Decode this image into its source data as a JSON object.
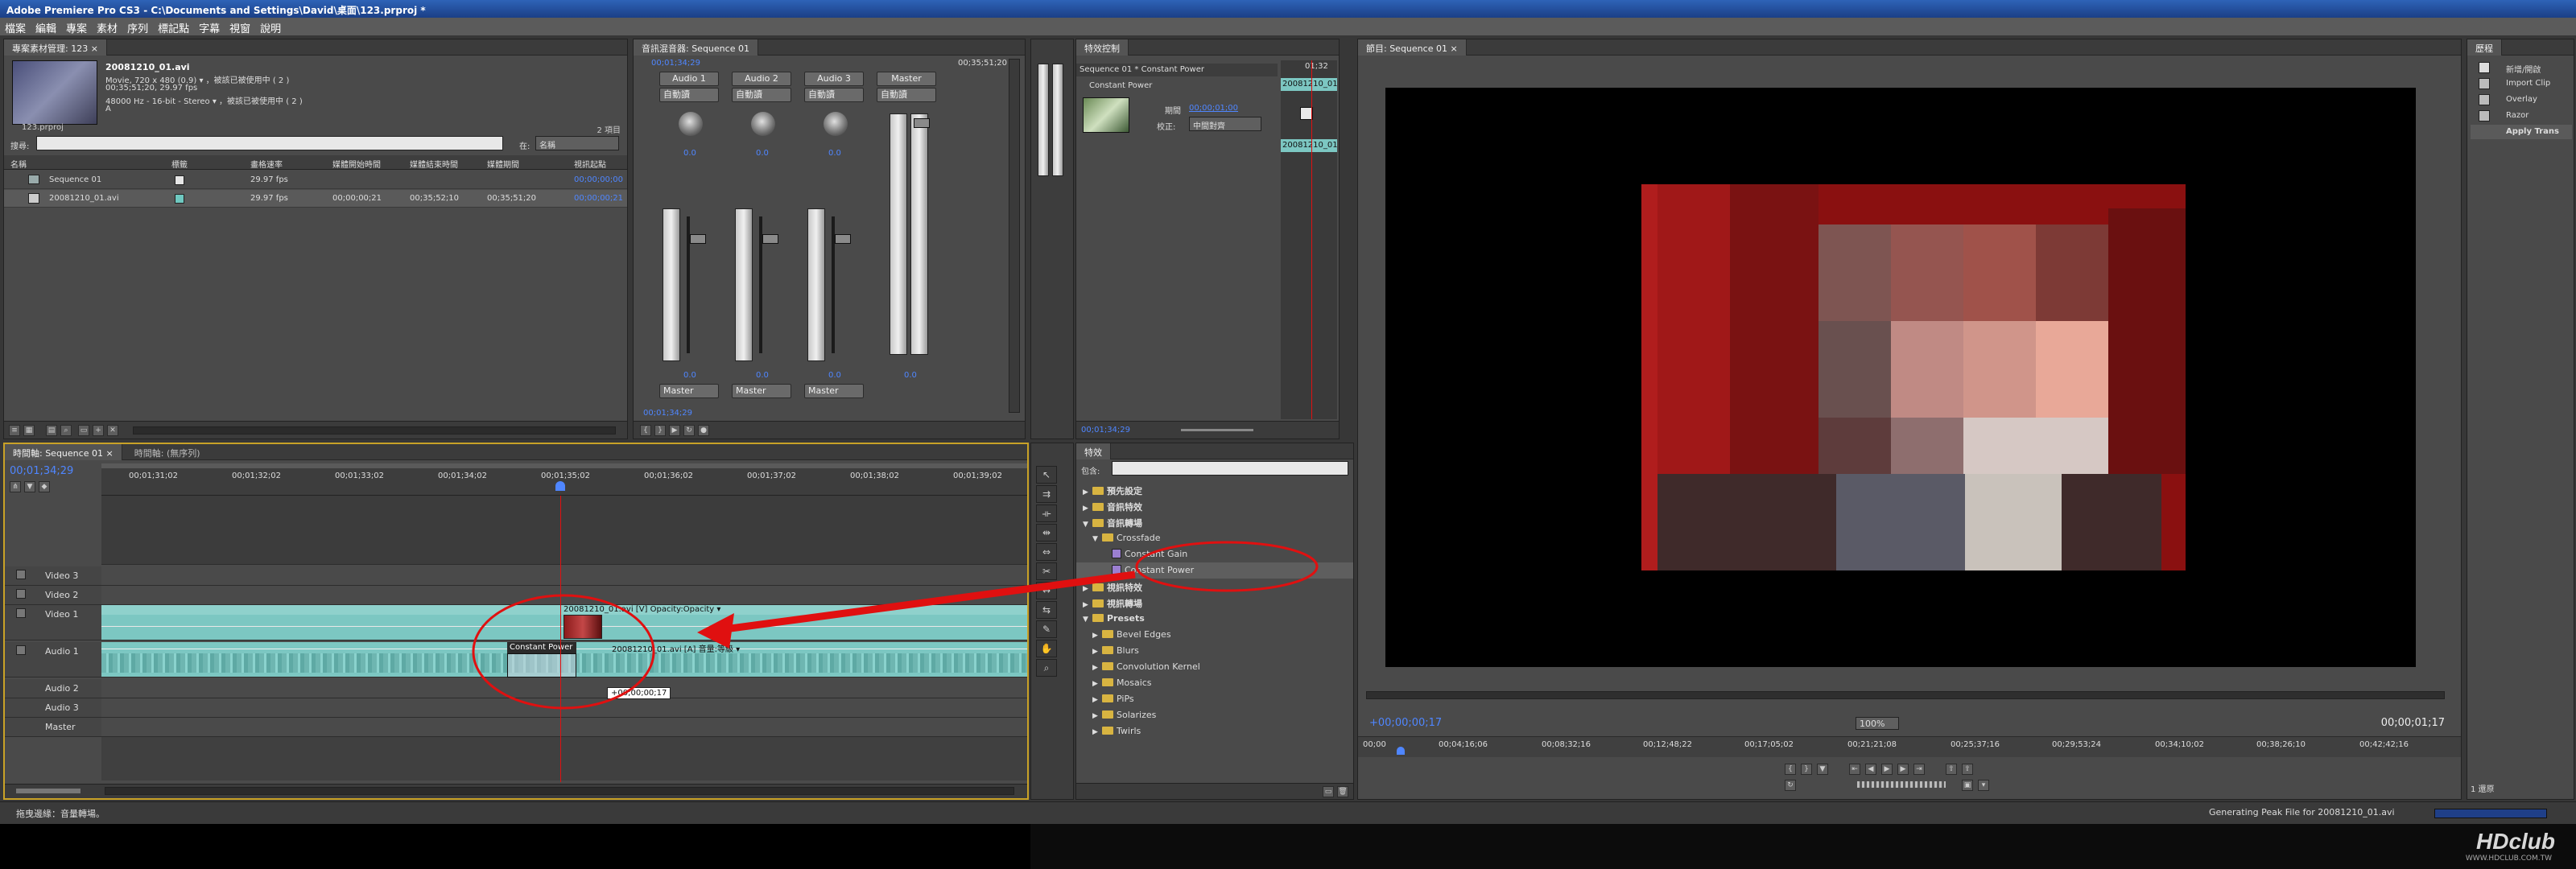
{
  "app": {
    "title": "Adobe Premiere Pro CS3 - C:\\Documents and Settings\\David\\桌面\\123.prproj *"
  },
  "menu": [
    "檔案",
    "編輯",
    "專案",
    "素材",
    "序列",
    "標記點",
    "字幕",
    "視窗",
    "說明"
  ],
  "project": {
    "tab": "專案素材管理: 123 ×",
    "clip_name": "20081210_01.avi",
    "clip_info": [
      "Movie, 720 x 480 (0.9) ▾ ，被該已被使用中 ( 2 )",
      "00;35;51;20, 29.97 fps",
      "48000 Hz - 16-bit - Stereo ▾ ，被該已被使用中 ( 2 )",
      "A"
    ],
    "project_file": "123.prproj",
    "item_count": "2 項目",
    "search_label": "搜尋:",
    "in_label": "在:",
    "in_value": "名稱",
    "columns": [
      "名稱",
      "標籤",
      "畫格速率",
      "媒體開始時間",
      "媒體結束時間",
      "媒體期間",
      "視訊起點"
    ],
    "rows": [
      {
        "name": "Sequence 01",
        "rate": "29.97 fps",
        "start": "",
        "end": "",
        "dur": "",
        "vin": "00;00;00;00"
      },
      {
        "name": "20081210_01.avi",
        "rate": "29.97 fps",
        "start": "00;00;00;21",
        "end": "00;35;52;10",
        "dur": "00;35;51;20",
        "vin": "00;00;00;21"
      }
    ]
  },
  "mixer": {
    "tab": "音訊混音器: Sequence 01",
    "timecode_left": "00;01;34;29",
    "timecode_right": "00;35;51;20",
    "channels": [
      {
        "name": "Audio 1",
        "mode": "自動讀",
        "value": "0.0",
        "value2": "0.0",
        "output": "Master"
      },
      {
        "name": "Audio 2",
        "mode": "自動讀",
        "value": "0.0",
        "value2": "0.0",
        "output": "Master"
      },
      {
        "name": "Audio 3",
        "mode": "自動讀",
        "value": "0.0",
        "value2": "0.0",
        "output": "Master"
      },
      {
        "name": "Master",
        "mode": "自動讀",
        "value": "",
        "value2": "0.0",
        "output": ""
      }
    ],
    "bottom_timecode": "00;01;34;29"
  },
  "effect_controls": {
    "tab": "特效控制",
    "header": "Sequence 01 * Constant Power",
    "effect_name": "Constant Power",
    "clip_a": "20081210_01",
    "clip_b": "20081210_01",
    "duration_label": "期間",
    "duration_value": "00;00;01;00",
    "align_label": "校正:",
    "align_value": "中間對齊",
    "ruler_time": "01;32",
    "bottom_timecode": "00;01;34;29"
  },
  "effects": {
    "tab": "特效",
    "search_label": "包含:",
    "tree": [
      {
        "label": "預先設定",
        "level": 0,
        "type": "folder"
      },
      {
        "label": "音訊特效",
        "level": 0,
        "type": "folder"
      },
      {
        "label": "音訊轉場",
        "level": 0,
        "type": "folder",
        "open": true
      },
      {
        "label": "Crossfade",
        "level": 1,
        "type": "folder",
        "open": true
      },
      {
        "label": "Constant Gain",
        "level": 2,
        "type": "item"
      },
      {
        "label": "Constant Power",
        "level": 2,
        "type": "item",
        "selected": true
      },
      {
        "label": "視訊特效",
        "level": 0,
        "type": "folder"
      },
      {
        "label": "視訊轉場",
        "level": 0,
        "type": "folder"
      },
      {
        "label": "Presets",
        "level": 0,
        "type": "folder",
        "open": true
      },
      {
        "label": "Bevel Edges",
        "level": 1,
        "type": "folder"
      },
      {
        "label": "Blurs",
        "level": 1,
        "type": "folder"
      },
      {
        "label": "Convolution Kernel",
        "level": 1,
        "type": "folder"
      },
      {
        "label": "Mosaics",
        "level": 1,
        "type": "folder"
      },
      {
        "label": "PiPs",
        "level": 1,
        "type": "folder"
      },
      {
        "label": "Solarizes",
        "level": 1,
        "type": "folder"
      },
      {
        "label": "Twirls",
        "level": 1,
        "type": "folder"
      }
    ]
  },
  "program": {
    "tab": "節目: Sequence 01 ×",
    "timecode_left": "+00;00;00;17",
    "timecode_right": "00;00;01;17",
    "zoom": "100%",
    "ruler": [
      "00;00",
      "00;04;16;06",
      "00;08;32;16",
      "00;12;48;22",
      "00;17;05;02",
      "00;21;21;08",
      "00;25;37;16",
      "00;29;53;24",
      "00;34;10;02",
      "00;38;26;10",
      "00;42;42;16"
    ]
  },
  "history": {
    "tab": "歷程",
    "items": [
      "新增/開啟",
      "Import Clip",
      "Overlay",
      "Razor",
      "Apply Trans"
    ],
    "footer": "1 還原"
  },
  "timeline": {
    "tabs": [
      "時間軸: Sequence 01 ×",
      "時間軸: (無序列)"
    ],
    "timecode": "00;01;34;29",
    "ruler": [
      "00;01;31;02",
      "00;01;32;02",
      "00;01;33;02",
      "00;01;34;02",
      "00;01;35;02",
      "00;01;36;02",
      "00;01;37;02",
      "00;01;38;02",
      "00;01;39;02"
    ],
    "tracks": [
      "Video 3",
      "Video 2",
      "Video 1",
      "Audio 1",
      "Audio 2",
      "Audio 3",
      "Master"
    ],
    "video_clip_label": "20081210_01.avi [V]  Opacity:Opacity ▾",
    "transition_label": "Constant Power",
    "audio_clip_label": "20081210_01.avi [A] 音量:等級 ▾",
    "tooltip": "+00;00;00;17"
  },
  "statusbar": {
    "left": "拖曳邊緣：音量轉場。",
    "right": "Generating Peak File for 20081210_01.avi"
  },
  "watermark": {
    "brand": "HDclub",
    "url": "WWW.HDCLUB.COM.TW"
  },
  "colors": {
    "accent_blue": "#4f86ff",
    "annotation_red": "#e01010",
    "clip_teal": "#7cc7c2",
    "panel_bg": "#4a4a4a"
  }
}
